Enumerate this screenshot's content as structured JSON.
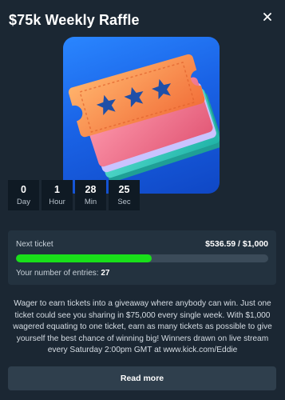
{
  "modal": {
    "title": "$75k Weekly Raffle",
    "close_icon": "close-icon",
    "artwork": "raffle-tickets-illustration"
  },
  "countdown": [
    {
      "value": "0",
      "label": "Day"
    },
    {
      "value": "1",
      "label": "Hour"
    },
    {
      "value": "28",
      "label": "Min"
    },
    {
      "value": "25",
      "label": "Sec"
    }
  ],
  "ticket": {
    "next_label": "Next ticket",
    "progress_text": "$536.59 / $1,000",
    "progress_fraction": 0.5366,
    "entries_label": "Your number of entries:",
    "entries_count": "27"
  },
  "description": "Wager to earn tickets into a giveaway where anybody can win. Just one ticket could see you sharing in $75,000 every single week. With $1,000 wagered equating to one ticket, earn as many tickets as possible to give yourself the best chance of winning big! Winners drawn on live stream every Saturday 2:00pm GMT at www.kick.com/Eddie",
  "read_more_label": "Read more",
  "colors": {
    "background": "#1b2733",
    "card": "#23323f",
    "progress": "#19e01a",
    "button": "#2f3f4d"
  }
}
